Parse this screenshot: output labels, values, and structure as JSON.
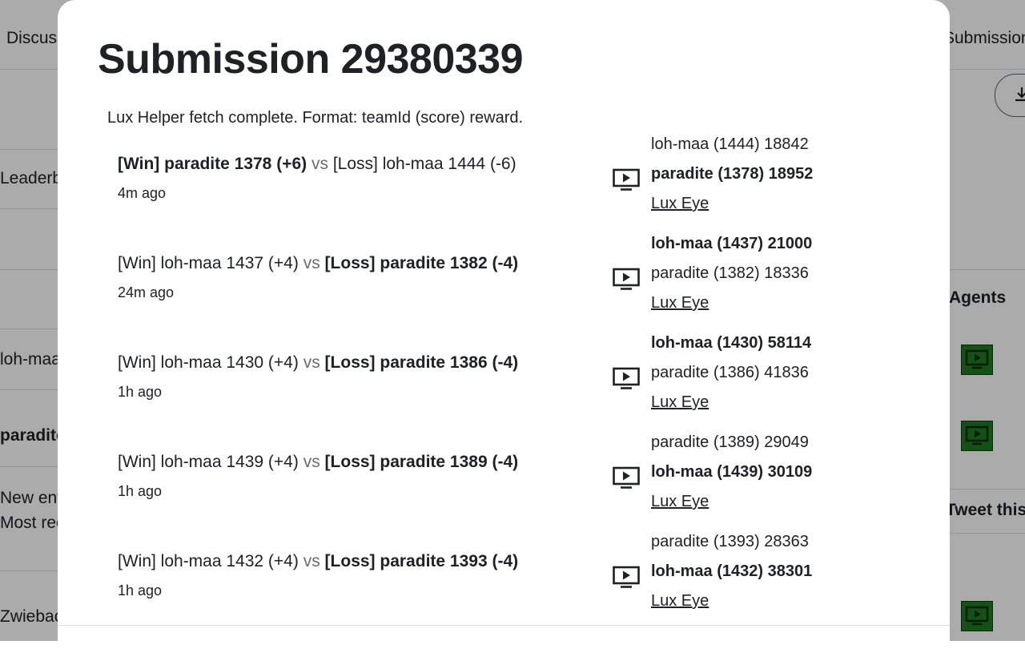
{
  "background": {
    "tab_left": "Discussion",
    "tab_right": "Submissions",
    "left_items": [
      "Leaderboard",
      "loh-maa",
      "paradite",
      "New entry!",
      "Most recent submission",
      "Zwieback"
    ],
    "right_title": "Agents",
    "right_button": "Tweet this"
  },
  "modal": {
    "title": "Submission 29380339",
    "status": "Lux Helper fetch complete. Format: teamId (score) reward.",
    "episodes": [
      {
        "part1": "[Win] paradite 1378 (+6)",
        "vs": "vs",
        "part2": "[Loss] loh-maa 1444 (-6)",
        "bold": "first",
        "time": "4m ago",
        "line1": "loh-maa (1444) 18842",
        "line2": "paradite (1378) 18952",
        "bold_line": 2,
        "link": "Lux Eye"
      },
      {
        "part1": "[Win] loh-maa 1437 (+4)",
        "vs": "vs",
        "part2": "[Loss] paradite 1382 (-4)",
        "bold": "second",
        "time": "24m ago",
        "line1": "loh-maa (1437) 21000",
        "line2": "paradite (1382) 18336",
        "bold_line": 1,
        "link": "Lux Eye"
      },
      {
        "part1": "[Win] loh-maa 1430 (+4)",
        "vs": "vs",
        "part2": "[Loss] paradite 1386 (-4)",
        "bold": "second",
        "time": "1h ago",
        "line1": "loh-maa (1430) 58114",
        "line2": "paradite (1386) 41836",
        "bold_line": 1,
        "link": "Lux Eye"
      },
      {
        "part1": "[Win] loh-maa 1439 (+4)",
        "vs": "vs",
        "part2": "[Loss] paradite 1389 (-4)",
        "bold": "second",
        "time": "1h ago",
        "line1": "paradite (1389) 29049",
        "line2": "loh-maa (1439) 30109",
        "bold_line": 2,
        "link": "Lux Eye"
      },
      {
        "part1": "[Win] loh-maa 1432 (+4)",
        "vs": "vs",
        "part2": "[Loss] paradite 1393 (-4)",
        "bold": "second",
        "time": "1h ago",
        "line1": "paradite (1393) 28363",
        "line2": "loh-maa (1432) 38301",
        "bold_line": 2,
        "link": "Lux Eye"
      }
    ]
  },
  "icons": {
    "play": "play-video-icon",
    "download": "download-icon"
  },
  "colors": {
    "play_button_bg": "#1f7a1f",
    "overlay": "rgba(0,0,0,0.33)"
  }
}
